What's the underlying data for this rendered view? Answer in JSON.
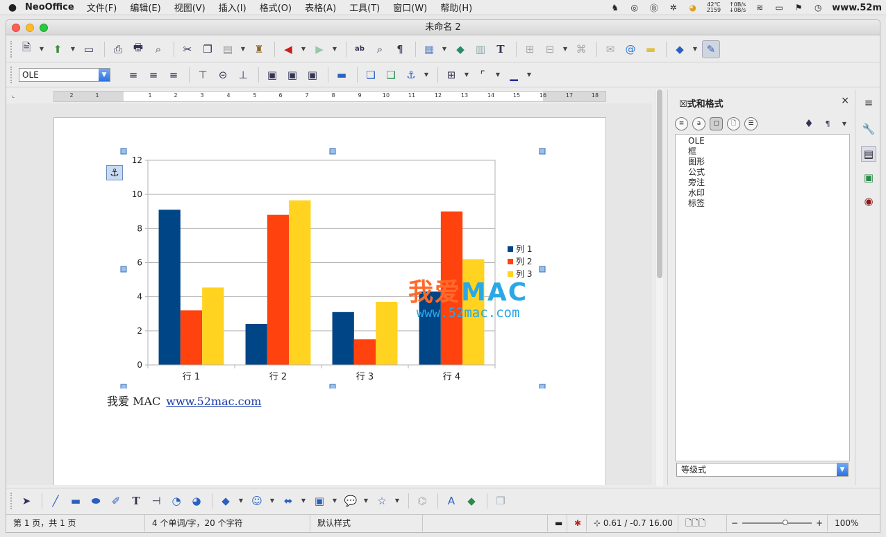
{
  "menubar": {
    "app_name": "NeoOffice",
    "menus": [
      "文件(F)",
      "编辑(E)",
      "视图(V)",
      "插入(I)",
      "格式(O)",
      "表格(A)",
      "工具(T)",
      "窗口(W)",
      "帮助(H)"
    ],
    "temp_top": "42℃",
    "temp_bottom": "2159",
    "net_up": "↑0B/s",
    "net_down": "↓0B/s",
    "clock_text": "www.52m"
  },
  "window": {
    "title": "未命名 2"
  },
  "format_toolbar": {
    "paragraph_style": "OLE"
  },
  "ruler": {
    "numbers": [
      "2",
      "1",
      "1",
      "2",
      "3",
      "4",
      "5",
      "6",
      "7",
      "8",
      "9",
      "10",
      "11",
      "12",
      "13",
      "14",
      "15",
      "16",
      "17",
      "18"
    ]
  },
  "chart_data": {
    "type": "bar",
    "categories": [
      "行 1",
      "行 2",
      "行 3",
      "行 4"
    ],
    "series": [
      {
        "name": "列 1",
        "color": "#004586",
        "values": [
          9.1,
          2.4,
          3.1,
          4.3
        ]
      },
      {
        "name": "列 2",
        "color": "#ff420e",
        "values": [
          3.2,
          8.8,
          1.5,
          9.0
        ]
      },
      {
        "name": "列 3",
        "color": "#ffd320",
        "values": [
          4.54,
          9.65,
          3.7,
          6.2
        ]
      }
    ],
    "yticks": [
      "0",
      "2",
      "4",
      "6",
      "8",
      "10",
      "12"
    ],
    "ylim": [
      0,
      12
    ],
    "grid": true,
    "legend": "right"
  },
  "document": {
    "text": "我爱 MAC",
    "link": "www.52mac.com"
  },
  "watermark": {
    "cn": "我爱",
    "en": "MAC",
    "url": "www.52mac.com"
  },
  "sidebar": {
    "title": "☒式和格式",
    "close": "×",
    "items": [
      "OLE",
      "框",
      "图形",
      "公式",
      "旁注",
      "水印",
      "标签"
    ],
    "filter": "等级式"
  },
  "statusbar": {
    "page": "第 1 页，共 1 页",
    "words": "4 个单词/字，20 个字符",
    "style": "默认样式",
    "position": "0.61 / -0.7",
    "size": "16.00",
    "zoom": "100%"
  },
  "colors": {
    "accent": "#2f72de",
    "handle": "#9cc0ec"
  }
}
